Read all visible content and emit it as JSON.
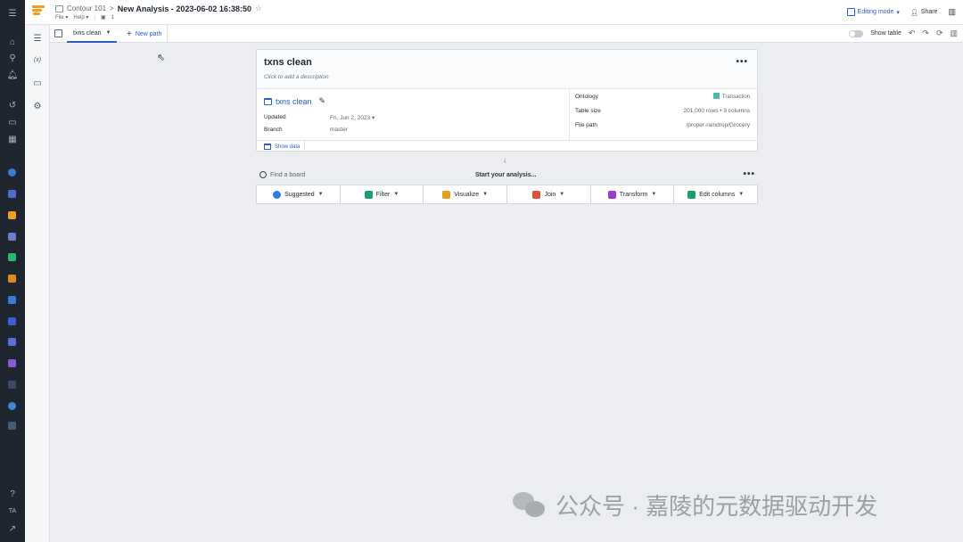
{
  "header": {
    "breadcrumb_parent": "Contour 101",
    "breadcrumb_sep": ">",
    "title": "New Analysis - 2023-06-02 16:38:50",
    "menus": {
      "file": "File ▾",
      "help": "Help ▾",
      "count": "1"
    },
    "editing_mode": "Editing mode",
    "share": "Share"
  },
  "tabs": {
    "active": "txns clean",
    "new_path": "New path",
    "show_table": "Show table"
  },
  "tools": {
    "variables": "(x)"
  },
  "rail": {
    "initials": "TA"
  },
  "card": {
    "title": "txns clean",
    "description_placeholder": "Click to add a description",
    "dataset_name": "txns clean",
    "updated_label": "Updated",
    "updated_value": "Fri, Jun 2, 2023",
    "branch_label": "Branch",
    "branch_value": "master",
    "ontology_label": "Ontology",
    "ontology_value": "Transaction",
    "table_size_label": "Table size",
    "table_size_value": "201,000 rows • 9 columns",
    "file_path_label": "File path",
    "file_path_value": "/proper-raindrop/Grocery",
    "show_data": "Show data"
  },
  "board": {
    "find_placeholder": "Find a board",
    "start": "Start your analysis..."
  },
  "actions": [
    {
      "label": "Suggested",
      "icon": "check-circle-icon",
      "color": "#2c7be5"
    },
    {
      "label": "Filter",
      "icon": "filter-icon",
      "color": "#1e9e6a"
    },
    {
      "label": "Visualize",
      "icon": "bar-chart-icon",
      "color": "#e0a020"
    },
    {
      "label": "Join",
      "icon": "join-icon",
      "color": "#e0503c"
    },
    {
      "label": "Transform",
      "icon": "transform-icon",
      "color": "#9a3cc8"
    },
    {
      "label": "Edit columns",
      "icon": "columns-icon",
      "color": "#1e9e6a"
    }
  ],
  "watermark": "公众号 · 嘉陵的元数据驱动开发",
  "colors": {
    "accent": "#2c5fc4",
    "rail": "#1f2630",
    "canvas": "#ebedf0"
  }
}
